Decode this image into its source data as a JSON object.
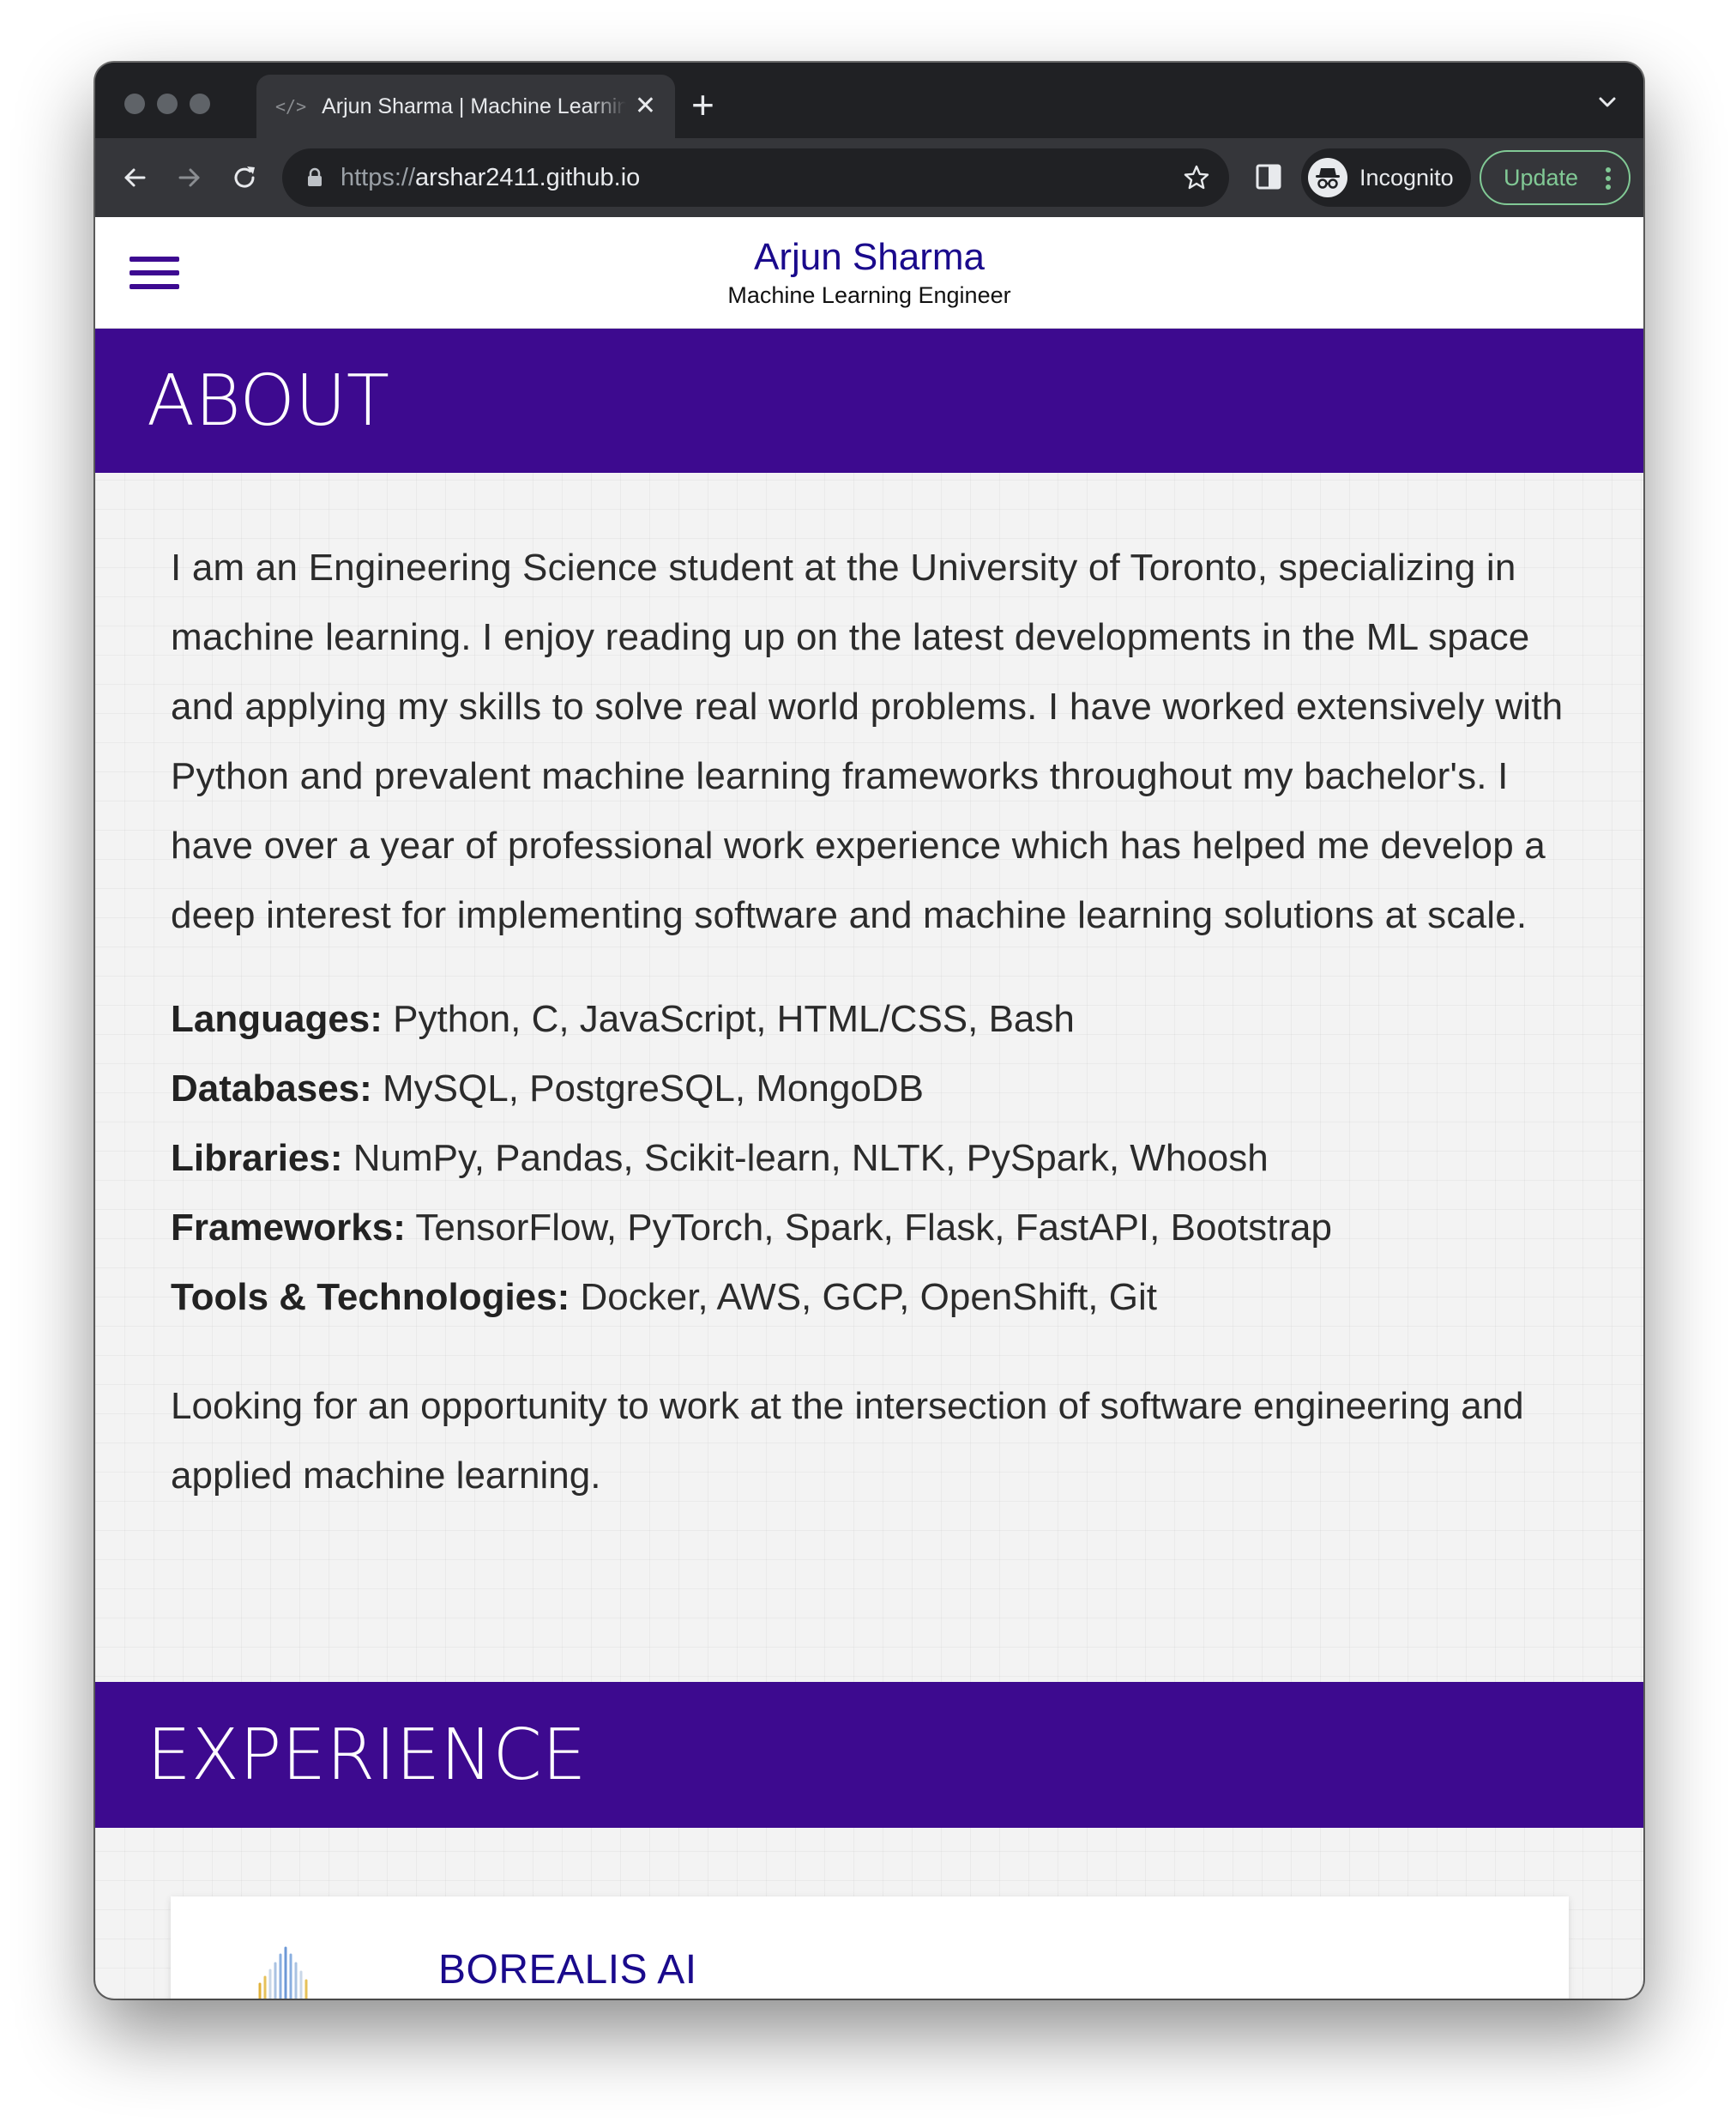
{
  "browser": {
    "tab_title": "Arjun Sharma | Machine Learning Engineer",
    "new_tab_symbol": "+",
    "tab_close_symbol": "✕",
    "url_scheme": "https://",
    "url_host": "arshar2411.github.io",
    "incognito_label": "Incognito",
    "update_label": "Update"
  },
  "header": {
    "name": "Arjun Sharma",
    "role": "Machine Learning Engineer"
  },
  "about": {
    "heading": "ABOUT",
    "paragraph": "I am an Engineering Science student at the University of Toronto, specializing in machine learning. I enjoy reading up on the latest developments in the ML space and applying my skills to solve real world problems. I have worked extensively with Python and prevalent machine learning frameworks throughout my bachelor's. I have over a year of professional work experience which has helped me develop a deep interest for implementing software and machine learning solutions at scale.",
    "skills": [
      {
        "label": "Languages:",
        "value": " Python, C, JavaScript, HTML/CSS, Bash"
      },
      {
        "label": "Databases:",
        "value": " MySQL, PostgreSQL, MongoDB"
      },
      {
        "label": "Libraries:",
        "value": " NumPy, Pandas, Scikit-learn, NLTK, PySpark, Whoosh"
      },
      {
        "label": "Frameworks:",
        "value": " TensorFlow, PyTorch, Spark, Flask, FastAPI, Bootstrap"
      },
      {
        "label": "Tools & Technologies:",
        "value": " Docker, AWS, GCP, OpenShift, Git"
      }
    ],
    "closing": "Looking for an opportunity to work at the intersection of software engineering and applied machine learning."
  },
  "experience": {
    "heading": "EXPERIENCE",
    "items": [
      {
        "company": "BOREALIS AI"
      }
    ]
  },
  "colors": {
    "banner": "#3d0a8f",
    "brand_text": "#1a0a8c",
    "update_accent": "#81c995"
  },
  "icons": [
    "code-favicon-icon",
    "close-icon",
    "plus-icon",
    "chevron-down-icon",
    "back-arrow-icon",
    "forward-arrow-icon",
    "reload-icon",
    "lock-icon",
    "star-icon",
    "side-panel-icon",
    "incognito-icon",
    "more-vert-icon",
    "hamburger-menu-icon",
    "borealis-logo"
  ]
}
